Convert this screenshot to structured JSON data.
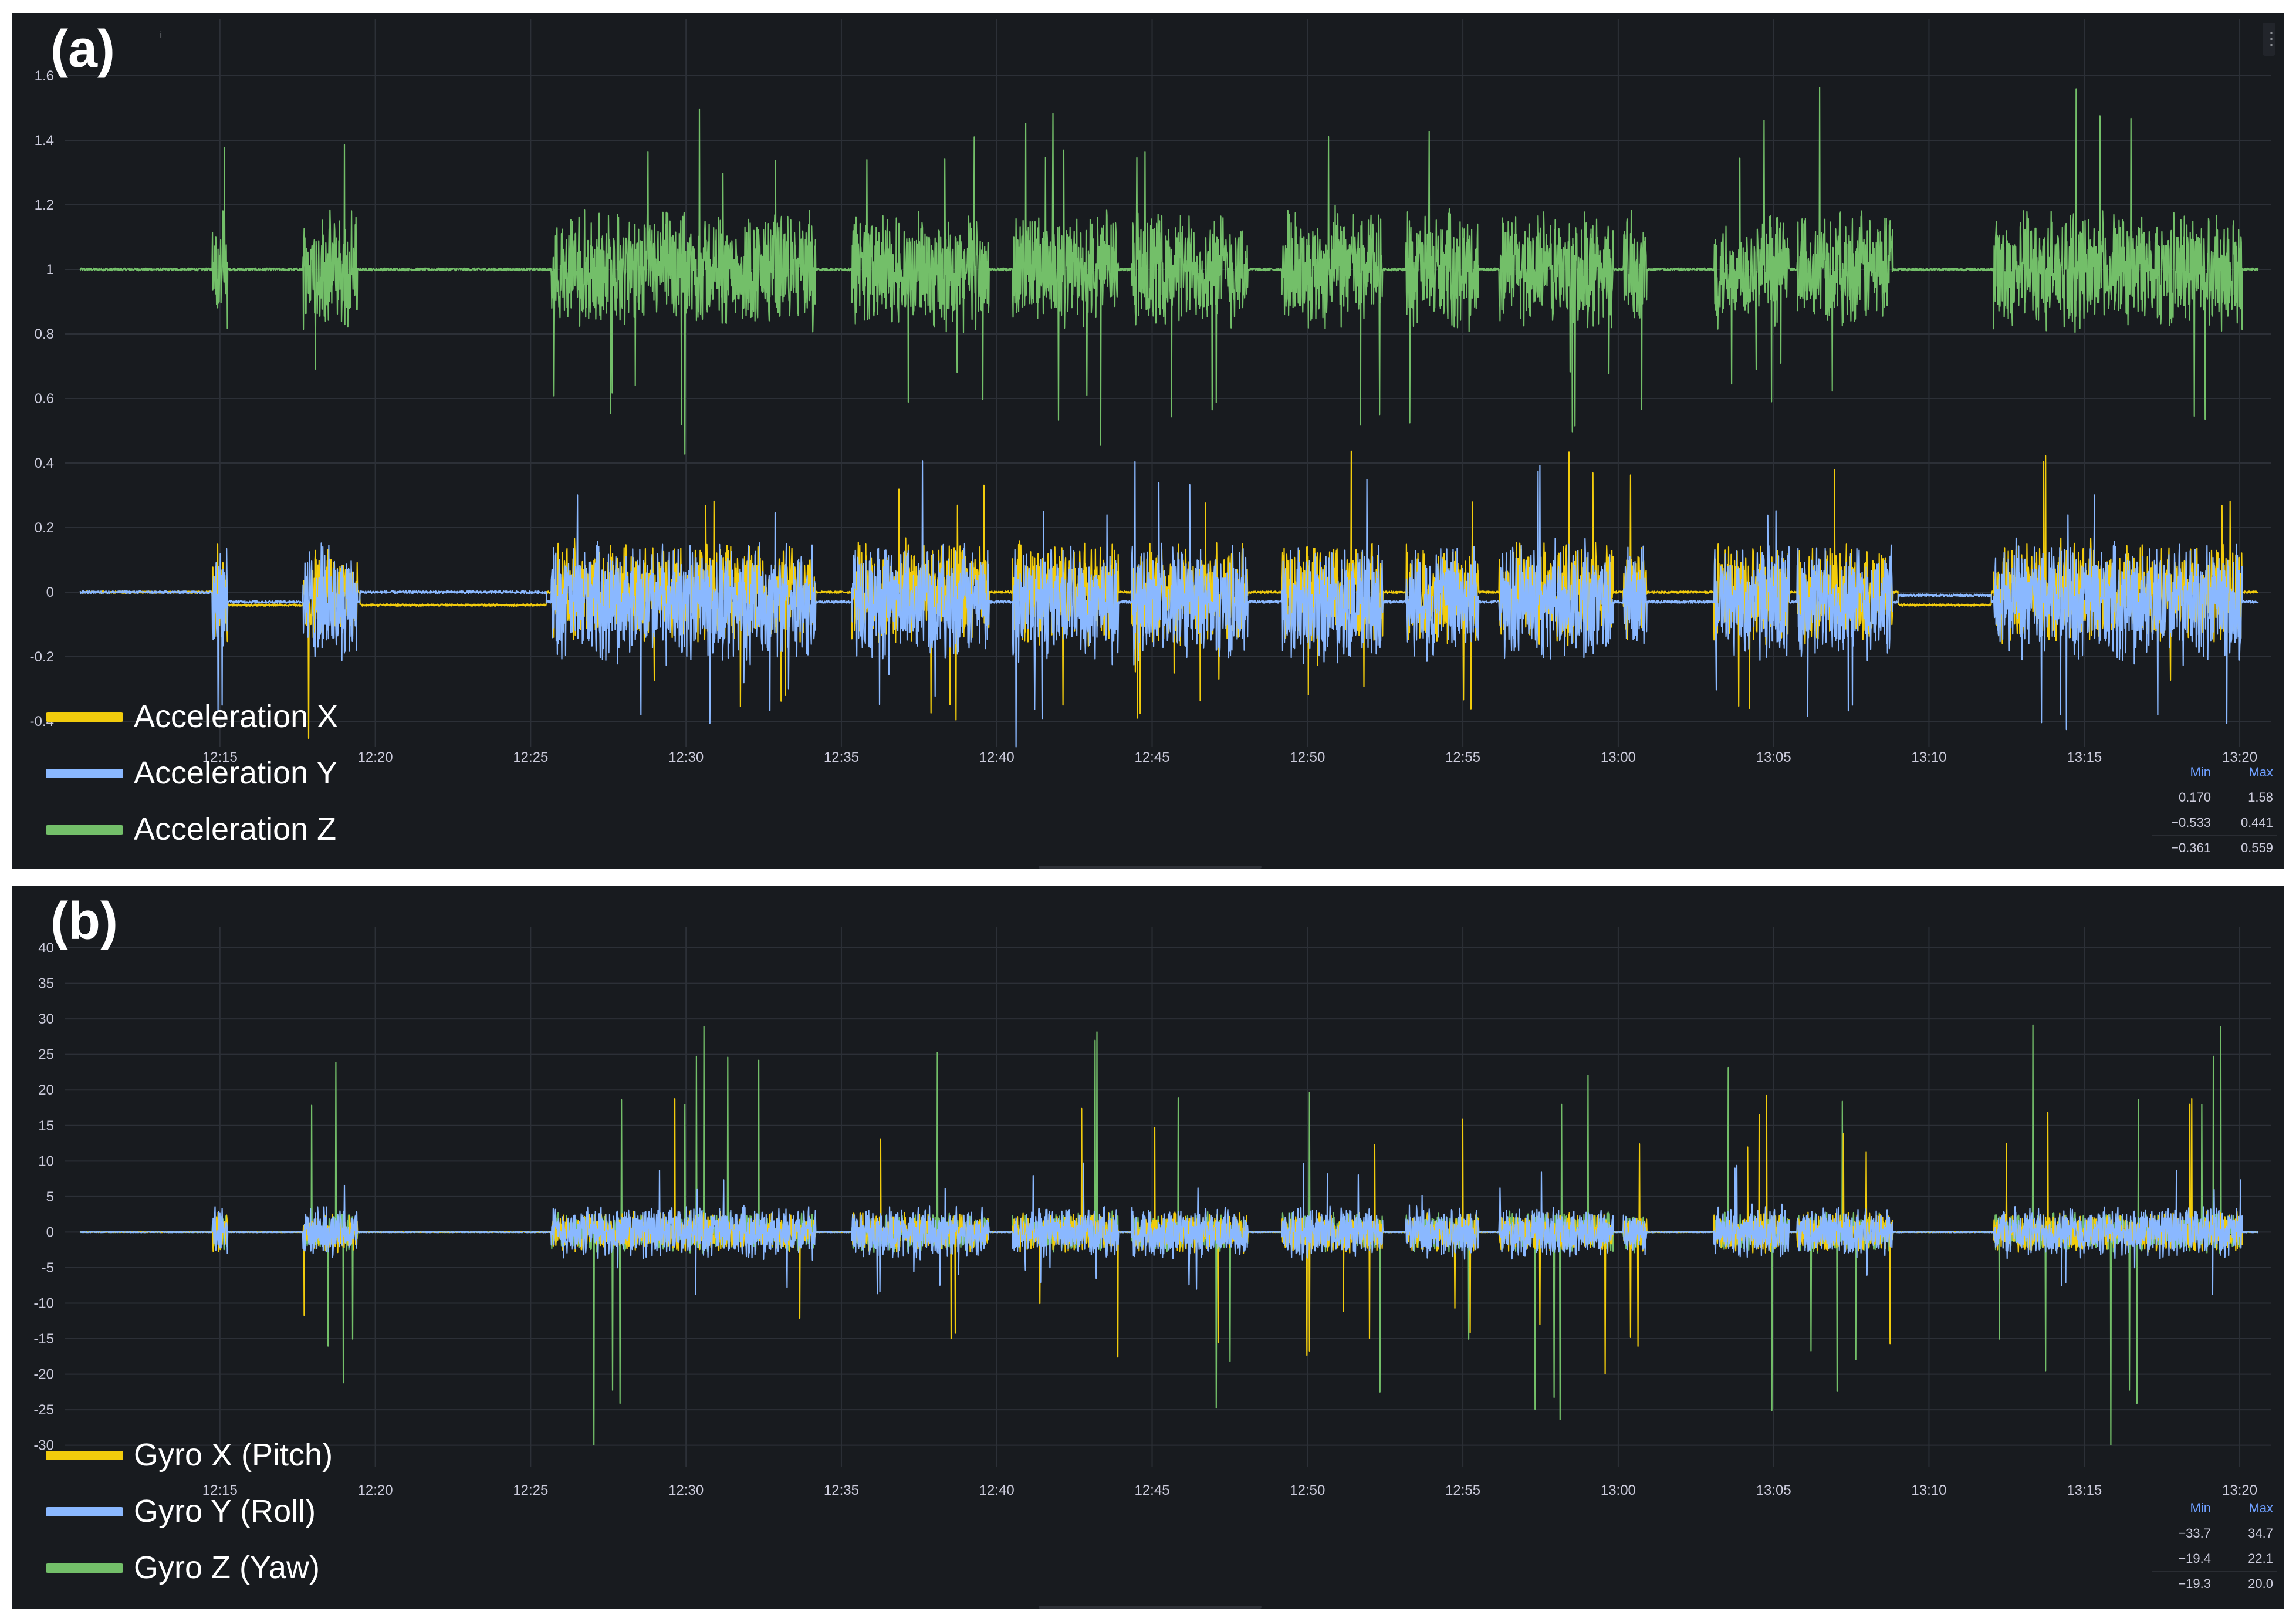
{
  "panels": [
    {
      "id": "a",
      "letter": "(a)",
      "legend": [
        "Acceleration X",
        "Acceleration Y",
        "Acceleration Z"
      ],
      "stats": {
        "headers": [
          "Min",
          "Max"
        ],
        "rows": [
          [
            "0.170",
            "1.58"
          ],
          [
            "−0.533",
            "0.441"
          ],
          [
            "−0.361",
            "0.559"
          ]
        ]
      }
    },
    {
      "id": "b",
      "letter": "(b)",
      "legend": [
        "Gyro X (Pitch)",
        "Gyro Y (Roll)",
        "Gyro Z (Yaw)"
      ],
      "stats": {
        "headers": [
          "Min",
          "Max"
        ],
        "rows": [
          [
            "−33.7",
            "34.7"
          ],
          [
            "−19.4",
            "22.1"
          ],
          [
            "−19.3",
            "20.0"
          ]
        ]
      }
    }
  ],
  "colors": {
    "x": "#f2cc0c",
    "y": "#8ab8ff",
    "z": "#73bf69",
    "background": "#181b1f",
    "grid": "#2c3037",
    "tick": "#ccccdc"
  },
  "chart_data": [
    {
      "type": "line",
      "x_ticks": [
        "12:15",
        "12:20",
        "12:25",
        "12:30",
        "12:35",
        "12:40",
        "12:45",
        "12:50",
        "12:55",
        "13:00",
        "13:05",
        "13:10",
        "13:15",
        "13:20"
      ],
      "y_ticks": [
        "1.6",
        "1.4",
        "1.2",
        "1",
        "0.8",
        "0.6",
        "0.4",
        "0.2",
        "0",
        "-0.2",
        "-0.4"
      ],
      "ylim": [
        -0.48,
        1.72
      ],
      "xlim": [
        "12:10",
        "13:21"
      ],
      "grid": true,
      "legend_position": "bottom-left",
      "series": [
        {
          "name": "Acceleration X",
          "color": "#f2cc0c",
          "baseline": 0.0,
          "amplitude": 0.17,
          "spike": 0.45
        },
        {
          "name": "Acceleration Y",
          "color": "#8ab8ff",
          "baseline": -0.02,
          "amplitude": 0.2,
          "spike": 0.45
        },
        {
          "name": "Acceleration Z",
          "color": "#73bf69",
          "baseline": 1.0,
          "amplitude": 0.2,
          "spike": 0.58
        }
      ],
      "active_segments": [
        [
          "12:14:45",
          "12:15:15"
        ],
        [
          "12:17:40",
          "12:19:25"
        ],
        [
          "12:25:40",
          "12:30:00"
        ],
        [
          "12:30:00",
          "12:34:10"
        ],
        [
          "12:35:20",
          "12:39:45"
        ],
        [
          "12:40:30",
          "12:43:55"
        ],
        [
          "12:44:20",
          "12:48:05"
        ],
        [
          "12:49:10",
          "12:52:25"
        ],
        [
          "12:53:10",
          "12:55:30"
        ],
        [
          "12:56:10",
          "12:59:50"
        ],
        [
          "13:00:10",
          "13:00:55"
        ],
        [
          "13:03:05",
          "13:05:30"
        ],
        [
          "13:05:45",
          "13:08:50"
        ],
        [
          "13:12:05",
          "13:20:05"
        ]
      ]
    },
    {
      "type": "line",
      "x_ticks": [
        "12:15",
        "12:20",
        "12:25",
        "12:30",
        "12:35",
        "12:40",
        "12:45",
        "12:50",
        "12:55",
        "13:00",
        "13:05",
        "13:10",
        "13:15",
        "13:20"
      ],
      "y_ticks": [
        "40",
        "35",
        "30",
        "25",
        "20",
        "15",
        "10",
        "5",
        "0",
        "-5",
        "-10",
        "-15",
        "-20",
        "-25",
        "-30"
      ],
      "ylim": [
        -33,
        40.5
      ],
      "xlim": [
        "12:10",
        "13:21"
      ],
      "grid": true,
      "legend_position": "bottom-left",
      "series": [
        {
          "name": "Gyro X (Pitch)",
          "color": "#f2cc0c",
          "baseline": 0,
          "amplitude": 3,
          "spike": 20
        },
        {
          "name": "Gyro Y (Roll)",
          "color": "#8ab8ff",
          "baseline": 0,
          "amplitude": 4,
          "spike": 10
        },
        {
          "name": "Gyro Z (Yaw)",
          "color": "#73bf69",
          "baseline": 0,
          "amplitude": 3,
          "spike": 30
        }
      ],
      "active_segments": [
        [
          "12:14:45",
          "12:15:15"
        ],
        [
          "12:17:40",
          "12:19:25"
        ],
        [
          "12:25:40",
          "12:30:00"
        ],
        [
          "12:30:00",
          "12:34:10"
        ],
        [
          "12:35:20",
          "12:39:45"
        ],
        [
          "12:40:30",
          "12:43:55"
        ],
        [
          "12:44:20",
          "12:48:05"
        ],
        [
          "12:49:10",
          "12:52:25"
        ],
        [
          "12:53:10",
          "12:55:30"
        ],
        [
          "12:56:10",
          "12:59:50"
        ],
        [
          "13:00:10",
          "13:00:55"
        ],
        [
          "13:03:05",
          "13:05:30"
        ],
        [
          "13:05:45",
          "13:08:50"
        ],
        [
          "13:12:05",
          "13:20:05"
        ]
      ]
    }
  ]
}
